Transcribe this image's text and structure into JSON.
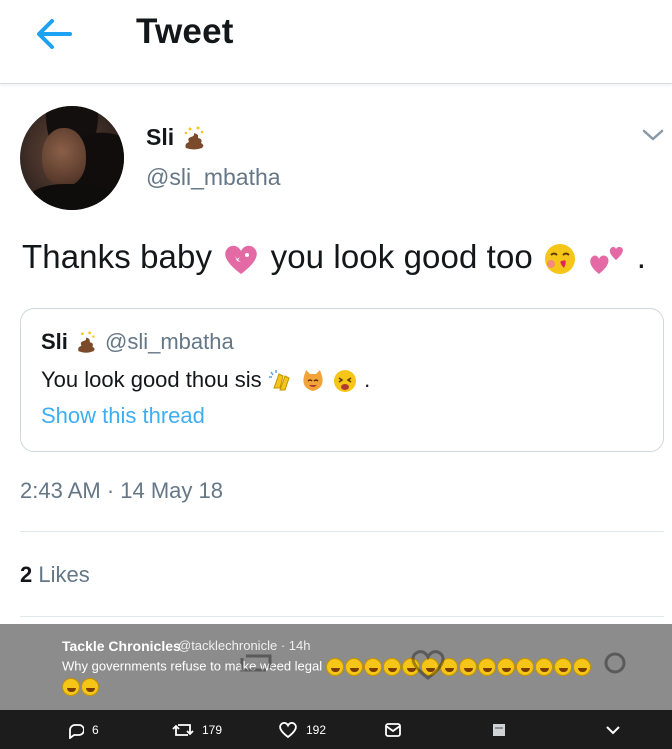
{
  "header": {
    "title": "Tweet",
    "back_icon": "arrow-left-icon",
    "accent_color": "#1da1f2"
  },
  "tweet": {
    "author_name": "Sli",
    "author_handle": "@sli_mbatha",
    "name_emoji": "pile-of-poo-with-sparkles-icon",
    "text_part1": "Thanks baby",
    "text_part2": " you look good too",
    "text_end": ".",
    "emojis": [
      "sparkling-heart-icon",
      "face-blowing-kiss-icon",
      "two-hearts-icon"
    ],
    "timestamp": "2:43 AM · 14 May 18",
    "likes_count": "2",
    "likes_label": "Likes"
  },
  "quoted": {
    "author_name": "Sli",
    "author_handle": "@sli_mbatha",
    "text": "You look good thou sis",
    "text_end": ".",
    "emojis": [
      "clapping-hands-icon",
      "smiling-cat-icon",
      "tired-face-icon"
    ],
    "show_thread": "Show this thread"
  },
  "overlay_tweet": {
    "author_name": "Tackle Chronicles",
    "author_handle": "@tacklechronicle",
    "time": "· 14h",
    "text": "Why governments refuse to make weed legal",
    "laugh_emoji_count_line1": 14,
    "laugh_emoji_count_line2": 2
  },
  "action_bar": {
    "replies": "6",
    "retweets": "179",
    "likes": "192"
  }
}
